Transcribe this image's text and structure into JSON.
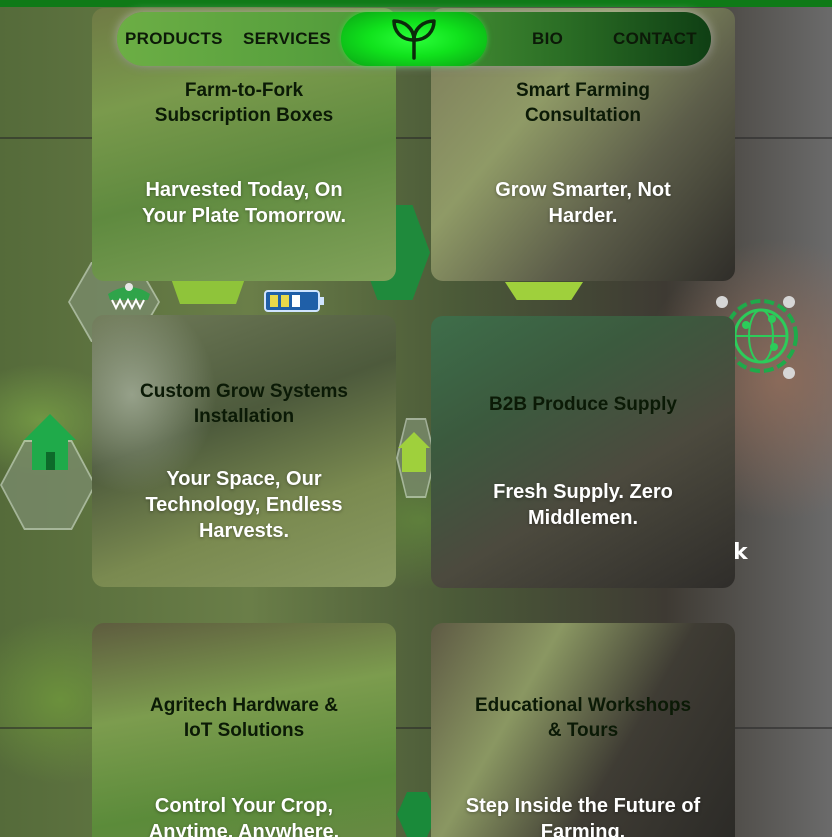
{
  "nav": {
    "items_left": [
      "PRODUCTS",
      "SERVICES"
    ],
    "items_right": [
      "BIO",
      "CONTACT"
    ],
    "logo_icon": "leaf-sprout-icon",
    "logo_color": "#10e21c"
  },
  "cards": [
    {
      "title_line1": "Farm-to-Fork",
      "title_line2": "Subscription Boxes",
      "tagline_line1": "Harvested Today, On",
      "tagline_line2": "Your Plate Tomorrow."
    },
    {
      "title_line1": "Smart Farming",
      "title_line2": "Consultation",
      "tagline_line1": "Grow Smarter, Not",
      "tagline_line2": "Harder."
    },
    {
      "title_line1": "Custom Grow Systems",
      "title_line2": "Installation",
      "tagline_line1": "Your Space, Our",
      "tagline_line2": "Technology, Endless",
      "tagline_line3": "Harvests."
    },
    {
      "title_line1": "B2B Produce Supply",
      "tagline_line1": "Fresh Supply. Zero",
      "tagline_line2": "Middlemen."
    },
    {
      "title_line1": "Agritech Hardware &",
      "title_line2": "IoT Solutions",
      "tagline_line1": "Control Your Crop,",
      "tagline_line2": "Anytime, Anywhere."
    },
    {
      "title_line1": "Educational Workshops",
      "title_line2": "& Tours",
      "tagline_line1": "Step Inside the Future of",
      "tagline_line2": "Farming."
    }
  ],
  "background": {
    "stray_text": "k",
    "icons": [
      "house-icon",
      "battery-icon",
      "shop-icon",
      "globe-network-icon"
    ],
    "colors": {
      "brand_green": "#0f7a17",
      "house_green": "#1faa4a"
    }
  }
}
